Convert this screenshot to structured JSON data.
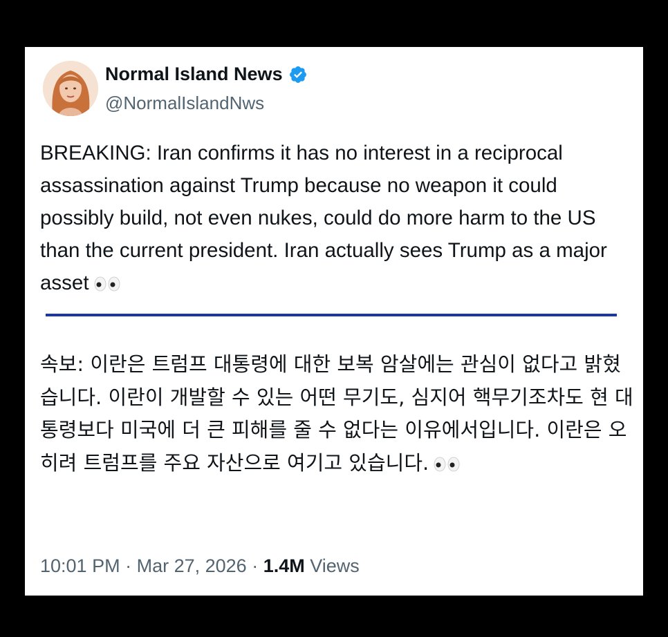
{
  "author": {
    "display_name": "Normal Island News",
    "handle": "@NormalIslandNws",
    "verified": true,
    "verified_color": "#1d9bf0"
  },
  "tweet": {
    "text_en": "BREAKING: Iran confirms it has no interest in a reciprocal assassination against Trump because no weapon it could possibly build, not even nukes, could do more harm to the US than the current president. Iran actually sees Trump as a major asset",
    "text_ko": "속보: 이란은 트럼프 대통령에 대한 보복 암살에는 관심이 없다고 밝혔습니다. 이란이 개발할 수 있는 어떤 무기도, 심지어 핵무기조차도 현 대통령보다 미국에 더 큰 피해를 줄 수 없다는 이유에서입니다. 이란은 오히려 트럼프를 주요 자산으로 여기고 있습니다.",
    "emoji_icon": "eyes-icon"
  },
  "meta": {
    "time": "10:01 PM",
    "separator": " · ",
    "date": "Mar 27, 2026",
    "views_count": "1.4M",
    "views_label": "Views"
  },
  "colors": {
    "divider": "#1f3896",
    "secondary_text": "#536471",
    "primary_text": "#0f1419"
  }
}
